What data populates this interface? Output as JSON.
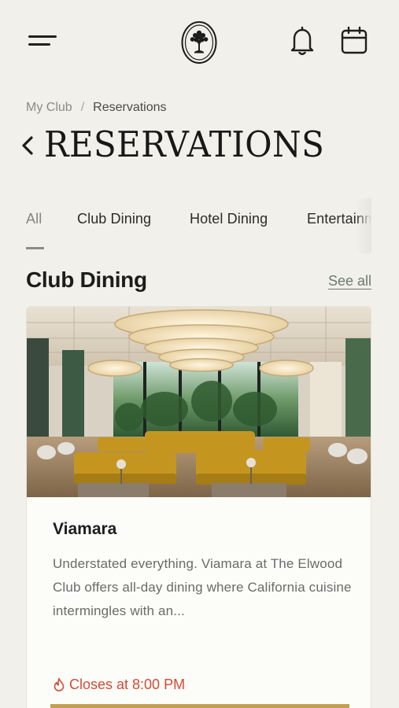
{
  "header": {
    "menu_icon": "hamburger-menu-icon",
    "logo_icon": "tree-crest-logo",
    "notifications_icon": "bell-icon",
    "calendar_icon": "calendar-icon"
  },
  "breadcrumb": {
    "items": [
      "My Club",
      "Reservations"
    ],
    "separator": "/"
  },
  "page": {
    "title": "RESERVATIONS",
    "back_icon": "chevron-left-icon"
  },
  "tabs": {
    "items": [
      {
        "label": "All",
        "active": true
      },
      {
        "label": "Club Dining",
        "active": false
      },
      {
        "label": "Hotel Dining",
        "active": false
      },
      {
        "label": "Entertainment",
        "active": false
      }
    ]
  },
  "section": {
    "title": "Club Dining",
    "see_all_label": "See all"
  },
  "card": {
    "name": "Viamara",
    "description": "Understated everything. Viamara at The Elwood Club offers all-day dining where California cuisine intermingles with an...",
    "status": "Closes at 8:00 PM",
    "status_icon": "flame-icon",
    "image": "restaurant-interior-photo"
  },
  "colors": {
    "background": "#f1f0ea",
    "status_red": "#d24c35",
    "accent_gold": "#c2a050",
    "link_green": "#6e7a6f"
  }
}
